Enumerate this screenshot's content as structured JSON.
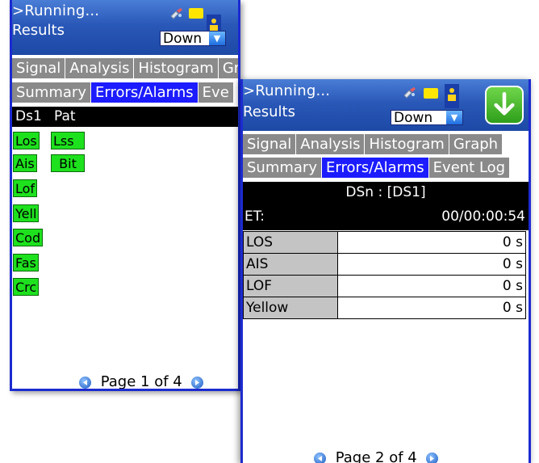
{
  "back_panel": {
    "status": ">Running...",
    "results_label": "Results",
    "dropdown_value": "Down",
    "tabs_row1": [
      "Signal",
      "Analysis",
      "Histogram",
      "Graph"
    ],
    "tabs_row2": [
      "Summary",
      "Errors/Alarms",
      "Eve"
    ],
    "active_tab_row2": "Errors/Alarms",
    "section_headers": [
      "Ds1",
      "Pat"
    ],
    "alarms_col1": [
      "Los",
      "Ais",
      "Lof",
      "Yell",
      "Cod",
      "Fas",
      "Crc"
    ],
    "alarms_col2": [
      "Lss",
      "Bit"
    ],
    "alarm_color": "#1ee11e",
    "pager": "Page 1 of 4"
  },
  "front_panel": {
    "status": ">Running...",
    "results_label": "Results",
    "dropdown_value": "Down",
    "tabs_row1": [
      "Signal",
      "Analysis",
      "Histogram",
      "Graph"
    ],
    "tabs_row2": [
      "Summary",
      "Errors/Alarms",
      "Event Log"
    ],
    "active_tab_row2": "Errors/Alarms",
    "dsn_title": "DSn : [DS1]",
    "et_label": "ET:",
    "et_value": "00/00:00:54",
    "rows": [
      {
        "label": "LOS",
        "value": "0 s"
      },
      {
        "label": "AIS",
        "value": "0 s"
      },
      {
        "label": "LOF",
        "value": "0 s"
      },
      {
        "label": "Yellow",
        "value": "0 s"
      }
    ],
    "pager": "Page 2 of 4"
  },
  "colors": {
    "header_blue": "#2a58b8",
    "active_tab": "#1c1cff",
    "inactive_tab": "#8a8a8a",
    "download_green": "#2e9e1a"
  },
  "icons": [
    "satellite-icon",
    "folder-icon",
    "person-icon",
    "download-arrow-icon",
    "dropdown-arrow-icon",
    "page-prev-icon",
    "page-next-icon"
  ]
}
